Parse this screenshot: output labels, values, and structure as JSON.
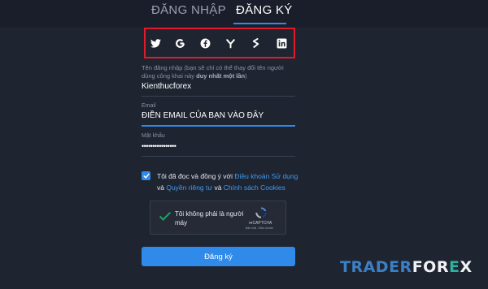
{
  "tabs": {
    "login": "ĐĂNG NHẬP",
    "register": "ĐĂNG KÝ"
  },
  "social": [
    "twitter-icon",
    "google-icon",
    "facebook-icon",
    "yahoo-icon",
    "stocktwits-icon",
    "linkedin-icon"
  ],
  "help_text": {
    "prefix": "Tên đăng nhập (bạn sẽ chỉ có thể thay đổi tên người dùng công khai này ",
    "bold": "duy nhất một lần",
    "suffix": ")"
  },
  "username": {
    "value": "Kienthucforex"
  },
  "email": {
    "label": "Email",
    "value": "ĐIỀN EMAIL CỦA BẠN VÀO ĐÂY"
  },
  "password": {
    "label": "Mật khẩu",
    "value": "••••••••••••••••"
  },
  "terms": {
    "text1": "Tôi đã đọc và đồng ý với ",
    "link1": "Điều khoản Sử dụng",
    "text2": " và ",
    "link2": "Quyền riêng tư",
    "text3": " và ",
    "link3": "Chính sách Cookies"
  },
  "captcha": {
    "label": "Tôi không phải là người máy",
    "brand": "reCAPTCHA",
    "terms": "Bảo mật - Điều khoản"
  },
  "submit_label": "Đăng ký",
  "watermark": {
    "part1": "TRADER",
    "part2": "FOR",
    "part3": "E",
    "part4": "X"
  },
  "colors": {
    "accent": "#2f8ae9",
    "highlight_box": "#e11b2a",
    "background": "#1f2431"
  }
}
